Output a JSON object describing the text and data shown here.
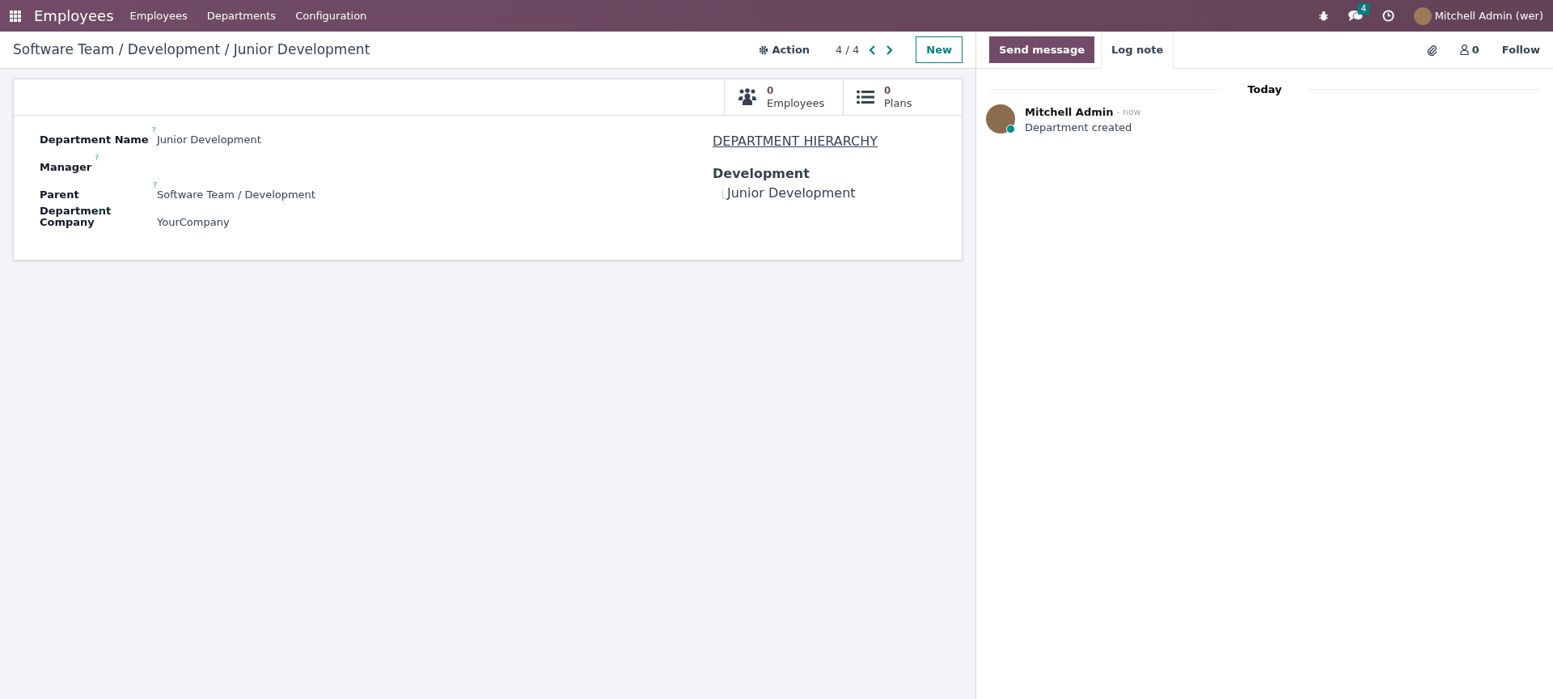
{
  "navbar": {
    "app_name": "Employees",
    "menu": [
      "Employees",
      "Departments",
      "Configuration"
    ],
    "messages_count": "4",
    "user": "Mitchell Admin (wer)"
  },
  "control_panel": {
    "breadcrumb": "Software Team / Development / Junior Development",
    "action": "Action",
    "pager": "4 / 4",
    "new_button": "New"
  },
  "smart_buttons": [
    {
      "kind": "employees",
      "count": "0",
      "label": "Employees"
    },
    {
      "kind": "plans",
      "count": "0",
      "label": "Plans"
    }
  ],
  "fields": [
    {
      "label": "Department Name",
      "help": "?",
      "value": "Junior Development"
    },
    {
      "label": "Manager",
      "help": "?"
    },
    {
      "label": "Parent Department",
      "help": "?",
      "value": "Software Team / Development"
    },
    {
      "label": "Company",
      "help": "?",
      "value": "YourCompany"
    }
  ],
  "hierarchy": {
    "title": "DEPARTMENT HIERARCHY",
    "parent": "Development",
    "children": [
      {
        "name": "Junior Development"
      }
    ]
  },
  "chatter": {
    "tabs": [
      {
        "label": "Send message",
        "selected": true
      },
      {
        "label": "Log note",
        "selected": false
      }
    ],
    "followers_count": "0",
    "follow": "Follow",
    "date_separator": "Today",
    "messages": [
      {
        "author": "Mitchell Admin",
        "time": "- now",
        "body": "Department created",
        "online": true
      }
    ]
  }
}
